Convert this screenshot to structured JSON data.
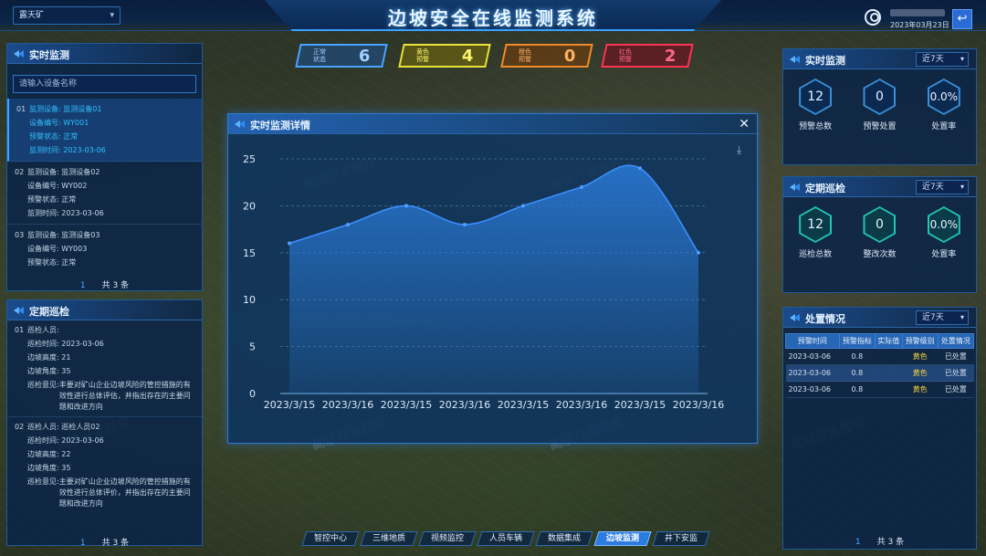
{
  "header": {
    "mine_selector_value": "露天矿",
    "title": "边坡安全在线监测系统",
    "date": "2023年03月23日",
    "back_icon": "back-arrow-icon"
  },
  "status_chips": [
    {
      "label_line1": "正常",
      "label_line2": "状态",
      "value": "6",
      "color": "#4aa3ff"
    },
    {
      "label_line1": "黄色",
      "label_line2": "预警",
      "value": "4",
      "color": "#e8e23a"
    },
    {
      "label_line1": "橙色",
      "label_line2": "预警",
      "value": "0",
      "color": "#f08a2a"
    },
    {
      "label_line1": "红色",
      "label_line2": "预警",
      "value": "2",
      "color": "#ff3355"
    }
  ],
  "left_realtime": {
    "title": "实时监测",
    "search_placeholder": "请输入设备名称",
    "devices": [
      {
        "idx": "01",
        "k1": "监测设备:",
        "v1": "监测设备01",
        "k2": "设备编号:",
        "v2": "WY001",
        "k3": "预警状态:",
        "v3": "正常",
        "k4": "监测时间:",
        "v4": "2023-03-06"
      },
      {
        "idx": "02",
        "k1": "监测设备:",
        "v1": "监测设备02",
        "k2": "设备编号:",
        "v2": "WY002",
        "k3": "预警状态:",
        "v3": "正常",
        "k4": "监测时间:",
        "v4": "2023-03-06"
      },
      {
        "idx": "03",
        "k1": "监测设备:",
        "v1": "监测设备03",
        "k2": "设备编号:",
        "v2": "WY003",
        "k3": "预警状态:",
        "v3": "正常"
      }
    ],
    "pager_page": "1",
    "pager_total": "共 3 条"
  },
  "left_inspection": {
    "title": "定期巡检",
    "items": [
      {
        "idx": "01",
        "k1": "巡检人员:",
        "v1": "",
        "k2": "巡检时间:",
        "v2": "2023-03-06",
        "k3": "边坡高度:",
        "v3": "21",
        "k4": "边坡角度:",
        "v4": "35",
        "k5": "巡检意见:",
        "v5": "丰要对矿山企业边坡风险的管控措施的有效性进行总体评估，并指出存在的主要问题和改进方向"
      },
      {
        "idx": "02",
        "k1": "巡检人员:",
        "v1": "巡检人员02",
        "k2": "巡检时间:",
        "v2": "2023-03-06",
        "k3": "边坡高度:",
        "v3": "22",
        "k4": "边坡角度:",
        "v4": "35",
        "k5": "巡检意见:",
        "v5": "主要对矿山企业边坡风险的管控措施的有效性进行总体评价，并指出存在的主要问题和改进方向"
      }
    ],
    "pager_page": "1",
    "pager_total": "共 3 条"
  },
  "right_realtime": {
    "title": "实时监测",
    "filter": "近7天",
    "stats": [
      {
        "value": "12",
        "caption": "预警总数"
      },
      {
        "value": "0",
        "caption": "预警处置"
      },
      {
        "value": "0.0%",
        "caption": "处置率"
      }
    ]
  },
  "right_inspection": {
    "title": "定期巡检",
    "filter": "近7天",
    "stats": [
      {
        "value": "12",
        "caption": "巡检总数"
      },
      {
        "value": "0",
        "caption": "整改次数"
      },
      {
        "value": "0.0%",
        "caption": "处置率"
      }
    ]
  },
  "right_disposal": {
    "title": "处置情况",
    "filter": "近7天",
    "columns": [
      "预警时间",
      "预警指标",
      "实际值",
      "预警级别",
      "处置情况"
    ],
    "rows": [
      [
        "2023-03-06",
        "0.8",
        "",
        "黄色",
        "已处置"
      ],
      [
        "2023-03-06",
        "0.8",
        "",
        "黄色",
        "已处置"
      ],
      [
        "2023-03-06",
        "0.8",
        "",
        "黄色",
        "已处置"
      ]
    ],
    "pager_page": "1",
    "pager_total": "共 3 条"
  },
  "modal": {
    "title": "实时监测详情",
    "close_icon": "close-icon",
    "download_icon": "download-icon"
  },
  "chart_data": {
    "type": "area",
    "x": [
      "2023/3/15",
      "2023/3/16",
      "2023/3/15",
      "2023/3/16",
      "2023/3/15",
      "2023/3/16",
      "2023/3/15",
      "2023/3/16"
    ],
    "values": [
      16,
      18,
      20,
      18,
      20,
      22,
      24,
      15
    ],
    "ylim": [
      0,
      25
    ],
    "yticks": [
      0,
      5,
      10,
      15,
      20,
      25
    ],
    "grid": true,
    "line_color": "#3a8fff",
    "fill_color": "#2a7ad8"
  },
  "bottom_nav": [
    {
      "label": "智控中心",
      "active": false
    },
    {
      "label": "三维地质",
      "active": false
    },
    {
      "label": "视频监控",
      "active": false
    },
    {
      "label": "人员车辆",
      "active": false
    },
    {
      "label": "数据集成",
      "active": false
    },
    {
      "label": "边坡监测",
      "active": true
    },
    {
      "label": "井下安监",
      "active": false
    }
  ],
  "watermark_text": "高级开发授权"
}
